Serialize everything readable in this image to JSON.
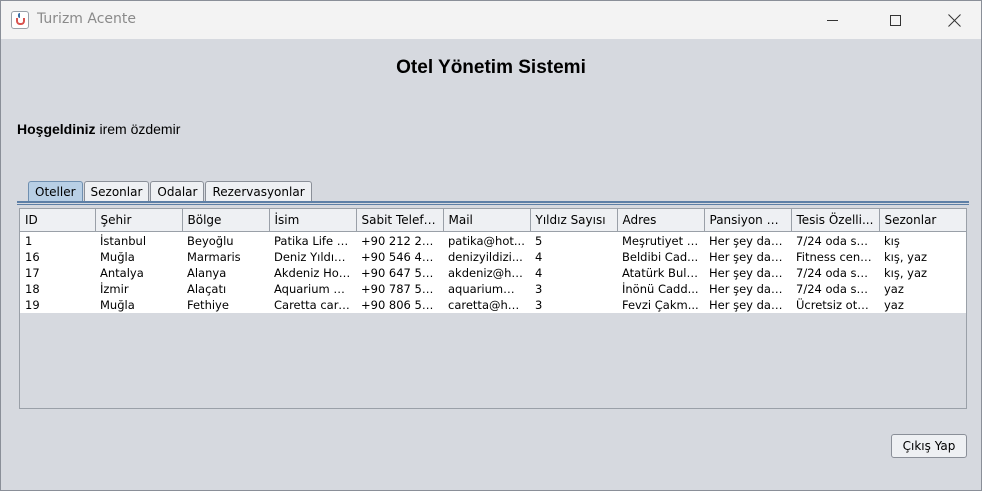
{
  "window": {
    "title": "Turizm Acente",
    "icon": "java-cup-icon"
  },
  "page": {
    "title": "Otel Yönetim Sistemi",
    "welcome_label": "Hoşgeldiniz",
    "user_name": "irem özdemir"
  },
  "tabs": [
    {
      "label": "Oteller",
      "active": true
    },
    {
      "label": "Sezonlar",
      "active": false
    },
    {
      "label": "Odalar",
      "active": false
    },
    {
      "label": "Rezervasyonlar",
      "active": false
    }
  ],
  "table": {
    "columns": [
      "ID",
      "Şehir",
      "Bölge",
      "İsim",
      "Sabit Telefon",
      "Mail",
      "Yıldız Sayısı",
      "Adres",
      "Pansiyon Ti...",
      "Tesis Özelli...",
      "Sezonlar"
    ],
    "rows": [
      [
        "1",
        "İstanbul",
        "Beyoğlu",
        "Patika Life İ...",
        "+90 212 29...",
        "patika@hot...",
        "5",
        "Meşrutiyet C...",
        "Her şey dah...",
        "7/24 oda ser...",
        "kış"
      ],
      [
        "16",
        "Muğla",
        "Marmaris",
        "Deniz Yıldızı ...",
        "+90 546 45...",
        "denizyildizi...",
        "4",
        "Beldibi Cad...",
        "Her şey dah...",
        "Fitness cent...",
        "kış, yaz"
      ],
      [
        "17",
        "Antalya",
        "Alanya",
        "Akdeniz Holi...",
        "+90 647 56...",
        "akdeniz@ho...",
        "4",
        "Atatürk Bulv...",
        "Her şey dah...",
        "7/24 oda ser...",
        "kış, yaz"
      ],
      [
        "18",
        "İzmir",
        "Alaçatı",
        "Aquarium H...",
        "+90 787 56...",
        "aquarium@...",
        "3",
        "İnönü Cadd...",
        "Her şey dah...",
        "7/24 oda ser...",
        "yaz"
      ],
      [
        "19",
        "Muğla",
        "Fethiye",
        "Caretta care...",
        "+90 806 54...",
        "caretta@hot...",
        "3",
        "Fevzi Çakm...",
        "Her şey dah...",
        "Ücretsiz oto...",
        "yaz"
      ]
    ]
  },
  "footer": {
    "exit_label": "Çıkış Yap"
  }
}
